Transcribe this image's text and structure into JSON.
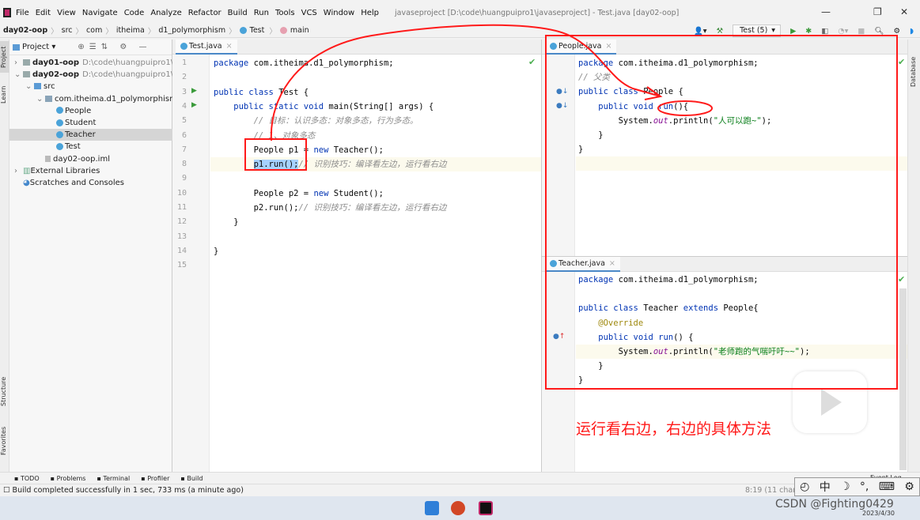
{
  "window": {
    "title": "javaseproject [D:\\code\\huangpuipro1\\javaseproject] - Test.java [day02-oop]",
    "minimize": "—",
    "restore": "❐",
    "close": "✕"
  },
  "menu": [
    "File",
    "Edit",
    "View",
    "Navigate",
    "Code",
    "Analyze",
    "Refactor",
    "Build",
    "Run",
    "Tools",
    "VCS",
    "Window",
    "Help"
  ],
  "breadcrumb": [
    "day02-oop",
    "src",
    "com",
    "itheima",
    "d1_polymorphism",
    "Test",
    "main"
  ],
  "toolbar": {
    "run_config": "Test (5)"
  },
  "side_tabs": {
    "project": "Project",
    "learn": "Learn",
    "structure": "Structure",
    "favorites": "Favorites",
    "database": "Database"
  },
  "project": {
    "header": "Project",
    "tree": [
      {
        "label": "day01-oop",
        "path": "D:\\code\\huangpuipro1\\jav",
        "level": 0,
        "arrow": ">",
        "bold": true,
        "icon": "module"
      },
      {
        "label": "day02-oop",
        "path": "D:\\code\\huangpuipro1\\jav",
        "level": 0,
        "arrow": "v",
        "bold": true,
        "icon": "module"
      },
      {
        "label": "src",
        "level": 1,
        "arrow": "v",
        "icon": "src"
      },
      {
        "label": "com.itheima.d1_polymorphism",
        "level": 2,
        "arrow": "v",
        "icon": "package"
      },
      {
        "label": "People",
        "level": 3,
        "icon": "class"
      },
      {
        "label": "Student",
        "level": 3,
        "icon": "class"
      },
      {
        "label": "Teacher",
        "level": 3,
        "icon": "class",
        "selected": true
      },
      {
        "label": "Test",
        "level": 3,
        "icon": "class"
      },
      {
        "label": "day02-oop.iml",
        "level": 2,
        "icon": "file"
      },
      {
        "label": "External Libraries",
        "level": 0,
        "arrow": ">",
        "icon": "lib"
      },
      {
        "label": "Scratches and Consoles",
        "level": 0,
        "icon": "scratch"
      }
    ]
  },
  "editors": {
    "test": {
      "tab": "Test.java",
      "lines": [
        [
          [
            "package ",
            "kw"
          ],
          [
            "com.itheima.d1_polymorphism;",
            ""
          ]
        ],
        [],
        [
          [
            "public class ",
            "kw"
          ],
          [
            "Test {",
            ""
          ]
        ],
        [
          [
            "    public static void ",
            "kw"
          ],
          [
            "main(String[] args) {",
            ""
          ]
        ],
        [
          [
            "        // 目标：认识多态：对象多态，行为多态。",
            "cm"
          ]
        ],
        [
          [
            "        // 1、对象多态",
            "cm"
          ]
        ],
        [
          [
            "        People p1 = ",
            ""
          ],
          [
            "new ",
            "kw"
          ],
          [
            "Teacher();",
            ""
          ]
        ],
        [
          [
            "        ",
            ""
          ],
          [
            "p1.run();",
            "sel"
          ],
          [
            "// 识别技巧：编译看左边，运行看右边",
            "cm"
          ]
        ],
        [],
        [
          [
            "        People p2 = ",
            ""
          ],
          [
            "new ",
            "kw"
          ],
          [
            "Student();",
            ""
          ]
        ],
        [
          [
            "        p2.run();",
            ""
          ],
          [
            "// 识别技巧：编译看左边，运行看右边",
            "cm"
          ]
        ],
        [
          [
            "    }",
            ""
          ]
        ],
        [],
        [
          [
            "}",
            ""
          ]
        ],
        []
      ]
    },
    "people": {
      "tab": "People.java",
      "lines": [
        [
          [
            "package ",
            "kw"
          ],
          [
            "com.itheima.d1_polymorphism;",
            ""
          ]
        ],
        [
          [
            "// 父类",
            "cm"
          ]
        ],
        [
          [
            "public class ",
            "kw"
          ],
          [
            "People {",
            ""
          ]
        ],
        [
          [
            "    public void ",
            "kw"
          ],
          [
            "run",
            "kw"
          ],
          [
            "(){",
            ""
          ]
        ],
        [
          [
            "        System.",
            ""
          ],
          [
            "out",
            "fd"
          ],
          [
            ".println(",
            ""
          ],
          [
            "\"人可以跑~\"",
            "st"
          ],
          [
            ");",
            ""
          ]
        ],
        [
          [
            "    }",
            ""
          ]
        ],
        [
          [
            "}",
            ""
          ]
        ]
      ]
    },
    "teacher": {
      "tab": "Teacher.java",
      "lines": [
        [
          [
            "package ",
            "kw"
          ],
          [
            "com.itheima.d1_polymorphism;",
            ""
          ]
        ],
        [],
        [
          [
            "public class ",
            "kw"
          ],
          [
            "Teacher ",
            ""
          ],
          [
            "extends ",
            "kw"
          ],
          [
            "People{",
            ""
          ]
        ],
        [
          [
            "    @Override",
            "an"
          ]
        ],
        [
          [
            "    public void ",
            "kw"
          ],
          [
            "run",
            "kw"
          ],
          [
            "() {",
            ""
          ]
        ],
        [
          [
            "        System.",
            ""
          ],
          [
            "out",
            "fd"
          ],
          [
            ".println(",
            ""
          ],
          [
            "\"老师跑的气喘吁吁~~\"",
            "st"
          ],
          [
            ");",
            ""
          ]
        ],
        [
          [
            "    }",
            ""
          ]
        ],
        [
          [
            "}",
            ""
          ]
        ]
      ]
    }
  },
  "bottom_tools": [
    "TODO",
    "Problems",
    "Terminal",
    "Profiler",
    "Build"
  ],
  "status": {
    "message": "Build completed successfully in 1 sec, 733 ms (a minute ago)",
    "position": "8:19 (11 chars",
    "event_log": "Event Log",
    "ime": "中"
  },
  "annotation": {
    "note": "运行看右边，右边的具体方法",
    "color": "#ff1a1a"
  },
  "overlay": {
    "watermark": "CSDN @Fighting0429",
    "date": "2023/4/30"
  }
}
